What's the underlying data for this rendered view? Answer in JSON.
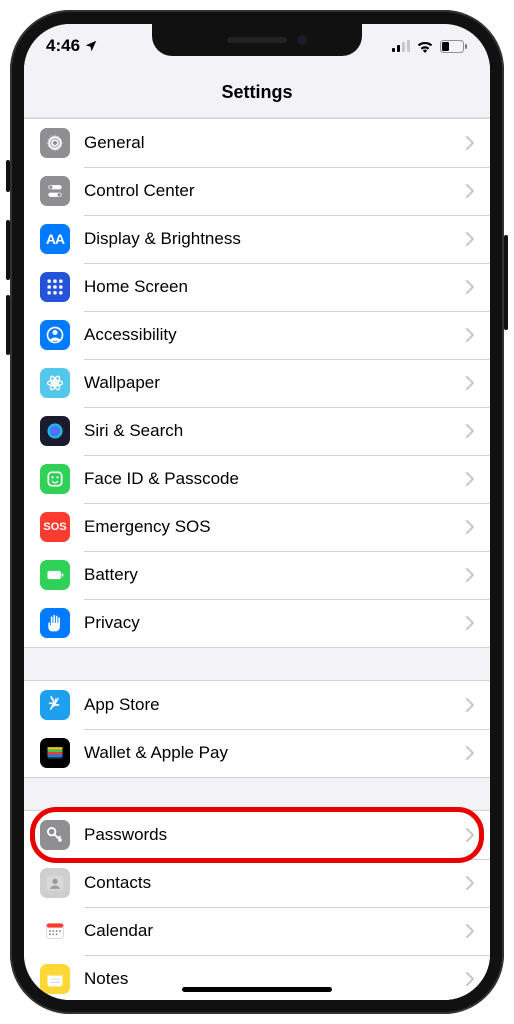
{
  "statusbar": {
    "time": "4:46"
  },
  "navbar": {
    "title": "Settings"
  },
  "groups": [
    {
      "rows": [
        {
          "id": "general",
          "label": "General",
          "icon": "gear",
          "bg": "#8e8e93"
        },
        {
          "id": "control-center",
          "label": "Control Center",
          "icon": "switches",
          "bg": "#8e8e93"
        },
        {
          "id": "display",
          "label": "Display & Brightness",
          "icon": "aa",
          "bg": "#007aff"
        },
        {
          "id": "home-screen",
          "label": "Home Screen",
          "icon": "grid",
          "bg": "#2452d9"
        },
        {
          "id": "accessibility",
          "label": "Accessibility",
          "icon": "person-circle",
          "bg": "#007aff"
        },
        {
          "id": "wallpaper",
          "label": "Wallpaper",
          "icon": "flower",
          "bg": "#54c7ec"
        },
        {
          "id": "siri",
          "label": "Siri & Search",
          "icon": "siri",
          "bg": "#1b1b2f"
        },
        {
          "id": "faceid",
          "label": "Face ID & Passcode",
          "icon": "face",
          "bg": "#30d158"
        },
        {
          "id": "sos",
          "label": "Emergency SOS",
          "icon": "sos",
          "bg": "#ff3b30"
        },
        {
          "id": "battery",
          "label": "Battery",
          "icon": "battery",
          "bg": "#30d158"
        },
        {
          "id": "privacy",
          "label": "Privacy",
          "icon": "hand",
          "bg": "#007aff"
        }
      ]
    },
    {
      "rows": [
        {
          "id": "app-store",
          "label": "App Store",
          "icon": "appstore",
          "bg": "#1e9ff0"
        },
        {
          "id": "wallet",
          "label": "Wallet & Apple Pay",
          "icon": "wallet",
          "bg": "#000000"
        }
      ]
    },
    {
      "rows": [
        {
          "id": "passwords",
          "label": "Passwords",
          "icon": "key",
          "bg": "#8e8e93",
          "highlight": true
        },
        {
          "id": "contacts",
          "label": "Contacts",
          "icon": "contacts",
          "bg": "#cfcfcf"
        },
        {
          "id": "calendar",
          "label": "Calendar",
          "icon": "calendar",
          "bg": "#ffffff"
        },
        {
          "id": "notes",
          "label": "Notes",
          "icon": "notes",
          "bg": "#fdd835"
        }
      ]
    }
  ]
}
